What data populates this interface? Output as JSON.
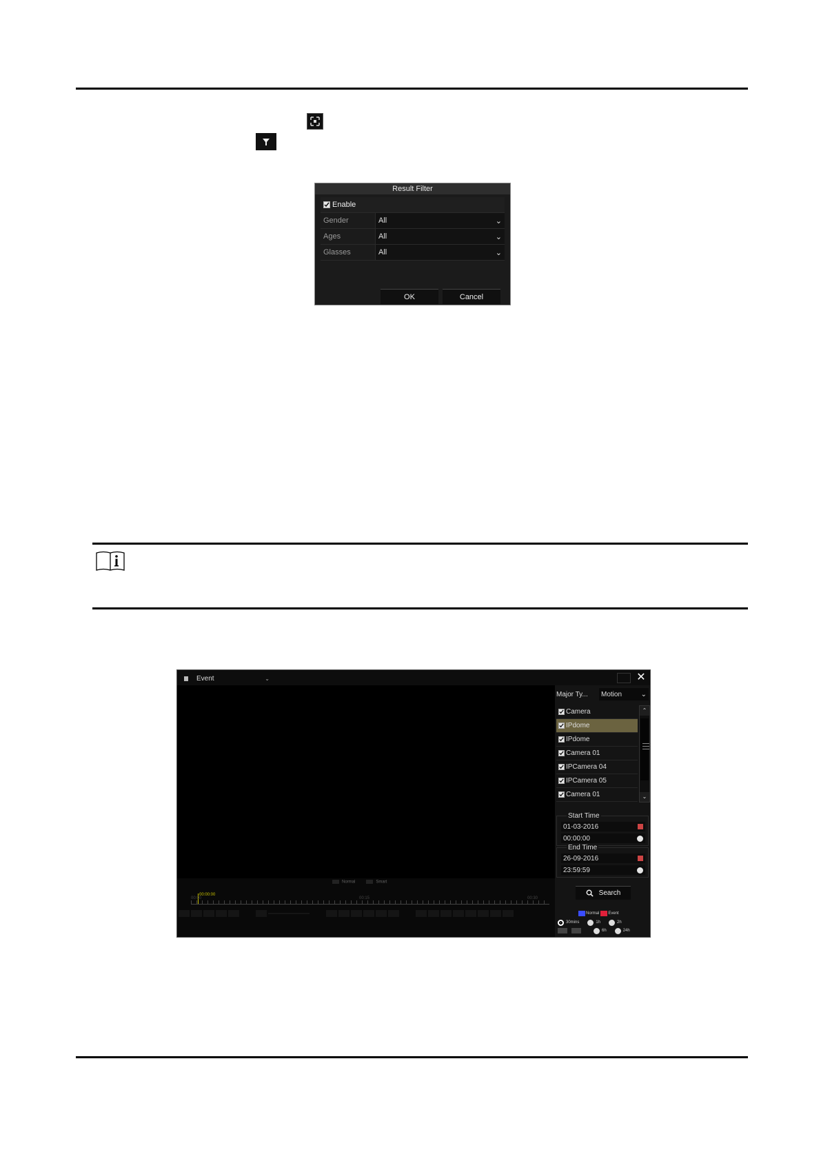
{
  "result_filter": {
    "title": "Result Filter",
    "enable_label": "Enable",
    "enable_checked": true,
    "rows": [
      {
        "label": "Gender",
        "value": "All"
      },
      {
        "label": "Ages",
        "value": "All"
      },
      {
        "label": "Glasses",
        "value": "All"
      }
    ],
    "ok_label": "OK",
    "cancel_label": "Cancel"
  },
  "inline_icons": [
    "fullscreen-icon",
    "filter-icon"
  ],
  "note": {
    "icon": "info-book-icon"
  },
  "playback": {
    "mode": "Event",
    "major_type_label": "Major Ty...",
    "major_type_value": "Motion",
    "cameras": [
      {
        "label": "Camera",
        "checked": true,
        "selected": false
      },
      {
        "label": "IPdome",
        "checked": true,
        "selected": true
      },
      {
        "label": "IPdome",
        "checked": true,
        "selected": false
      },
      {
        "label": "Camera 01",
        "checked": true,
        "selected": false
      },
      {
        "label": "IPCamera 04",
        "checked": true,
        "selected": false
      },
      {
        "label": "IPCamera 05",
        "checked": true,
        "selected": false
      },
      {
        "label": "Camera 01",
        "checked": true,
        "selected": false
      }
    ],
    "start_time": {
      "title": "Start Time",
      "date": "01-03-2016",
      "time": "00:00:00"
    },
    "end_time": {
      "title": "End Time",
      "date": "26-09-2016",
      "time": "23:59:59"
    },
    "search_label": "Search",
    "legend": [
      {
        "label": "Normal",
        "color": "#3a4dff"
      },
      {
        "label": "Event",
        "color": "#e0203a"
      }
    ],
    "ranges": [
      "30mins",
      "1h",
      "2h",
      "6h",
      "24h"
    ],
    "selected_range": "30mins",
    "timeline": {
      "legend": [
        "Normal",
        "Smart"
      ],
      "cursor_time": "00:00:00",
      "tick_labels": [
        "00:00",
        "00:15",
        "00:30"
      ]
    }
  }
}
